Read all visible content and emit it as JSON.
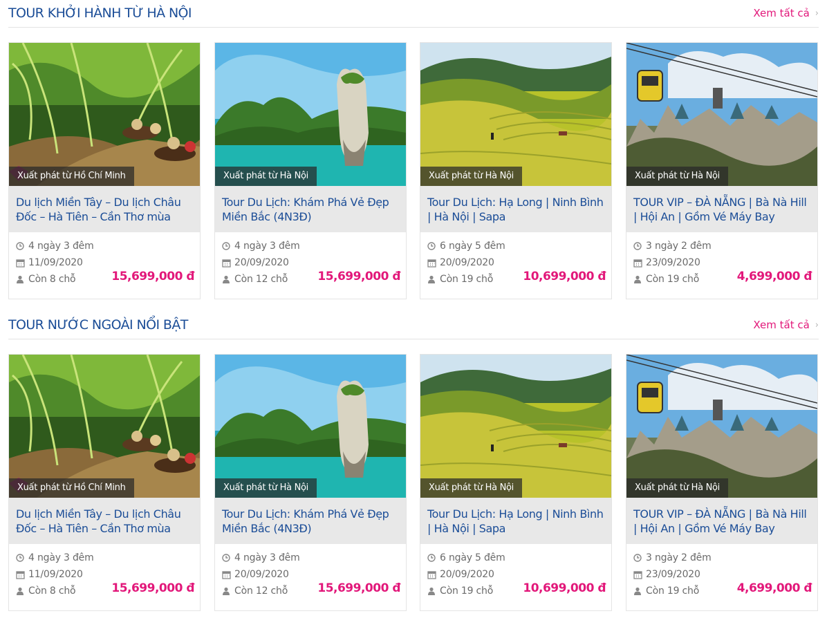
{
  "sections": [
    {
      "title": "TOUR KHỞI HÀNH TỪ HÀ NỘI",
      "view_all": "Xem tất cả",
      "cards": [
        {
          "depart": "Xuất phát từ Hồ Chí Minh",
          "title": "Du lịch Miền Tây – Du lịch Châu Đốc – Hà Tiên – Cần Thơ mùa",
          "duration": "4 ngày 3 đêm",
          "date": "11/09/2020",
          "seats": "Còn 8 chỗ",
          "price": "15,699,000 đ"
        },
        {
          "depart": "Xuất phát từ Hà Nội",
          "title": "Tour Du Lịch: Khám Phá Vẻ Đẹp Miền Bắc (4N3Đ)",
          "duration": "4 ngày 3 đêm",
          "date": "20/09/2020",
          "seats": "Còn 12 chỗ",
          "price": "15,699,000 đ"
        },
        {
          "depart": "Xuất phát từ Hà Nội",
          "title": "Tour Du Lịch: Hạ Long | Ninh Bình | Hà Nội | Sapa",
          "duration": "6 ngày 5 đêm",
          "date": "20/09/2020",
          "seats": "Còn 19 chỗ",
          "price": "10,699,000 đ"
        },
        {
          "depart": "Xuất phát từ Hà Nội",
          "title": "TOUR VIP – ĐÀ NẴNG | Bà Nà Hill | Hội An | Gồm Vé Máy Bay",
          "duration": "3 ngày 2 đêm",
          "date": "23/09/2020",
          "seats": "Còn 19 chỗ",
          "price": "4,699,000 đ"
        }
      ]
    },
    {
      "title": "TOUR NƯỚC NGOÀI NỔI BẬT",
      "view_all": "Xem tất cả",
      "cards": [
        {
          "depart": "Xuất phát từ Hồ Chí Minh",
          "title": "Du lịch Miền Tây – Du lịch Châu Đốc – Hà Tiên – Cần Thơ mùa",
          "duration": "4 ngày 3 đêm",
          "date": "11/09/2020",
          "seats": "Còn 8 chỗ",
          "price": "15,699,000 đ"
        },
        {
          "depart": "Xuất phát từ Hà Nội",
          "title": "Tour Du Lịch: Khám Phá Vẻ Đẹp Miền Bắc (4N3Đ)",
          "duration": "4 ngày 3 đêm",
          "date": "20/09/2020",
          "seats": "Còn 12 chỗ",
          "price": "15,699,000 đ"
        },
        {
          "depart": "Xuất phát từ Hà Nội",
          "title": "Tour Du Lịch: Hạ Long | Ninh Bình | Hà Nội | Sapa",
          "duration": "6 ngày 5 đêm",
          "date": "20/09/2020",
          "seats": "Còn 19 chỗ",
          "price": "10,699,000 đ"
        },
        {
          "depart": "Xuất phát từ Hà Nội",
          "title": "TOUR VIP – ĐÀ NẴNG | Bà Nà Hill | Hội An | Gồm Vé Máy Bay",
          "duration": "3 ngày 2 đêm",
          "date": "23/09/2020",
          "seats": "Còn 19 chỗ",
          "price": "4,699,000 đ"
        }
      ]
    }
  ],
  "icons": {
    "duration": "clock-icon",
    "date": "calendar-icon",
    "seats": "user-icon",
    "view_all": "chevron-right-icon"
  },
  "colors": {
    "heading": "#1b4d97",
    "accent": "#e2187a",
    "title_bg": "#e8e8e8"
  }
}
